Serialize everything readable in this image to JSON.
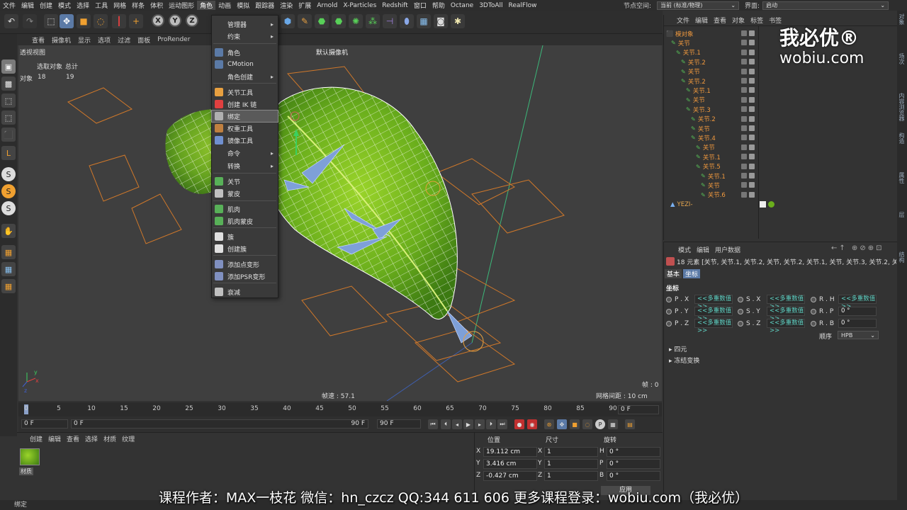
{
  "menubar": {
    "items": [
      "文件",
      "编辑",
      "创建",
      "模式",
      "选择",
      "工具",
      "网格",
      "样条",
      "体积",
      "运动图形",
      "角色",
      "动画",
      "模拟",
      "跟踪器",
      "渲染",
      "扩展",
      "Arnold",
      "X-Particles",
      "Redshift",
      "窗口",
      "帮助",
      "Octane",
      "3DToAll",
      "RealFlow"
    ],
    "active_index": 10,
    "node_space_label": "节点空间:",
    "node_space_value": "当前 (标准/物理)",
    "interface_label": "界面:",
    "interface_value": "启动"
  },
  "viewport_menu": [
    "查看",
    "摄像机",
    "显示",
    "选项",
    "过滤",
    "面板",
    "ProRender"
  ],
  "viewport": {
    "title": "透视视图",
    "camera_label": "默认摄像机",
    "stats_header_selected": "选取对象",
    "stats_header_total": "总计",
    "stats_row_label": "对象",
    "stats_selected": "18",
    "stats_total": "19",
    "speed": "帧速 : 57.1",
    "grid": "网格间距 : 10 cm",
    "frame": "帧 : 0"
  },
  "context_menu": {
    "items": [
      {
        "label": "管理器",
        "sub": true
      },
      {
        "label": "约束",
        "sub": true
      },
      {
        "label": "角色",
        "sub": false
      },
      {
        "label": "CMotion",
        "sub": false
      },
      {
        "label": "角色创建",
        "sub": true
      },
      {
        "label": "关节工具",
        "sub": false
      },
      {
        "label": "创建 IK 链",
        "sub": false
      },
      {
        "label": "绑定",
        "sub": false
      },
      {
        "label": "权重工具",
        "sub": false
      },
      {
        "label": "镜像工具",
        "sub": false
      },
      {
        "label": "命令",
        "sub": true
      },
      {
        "label": "转换",
        "sub": true
      },
      {
        "label": "关节",
        "sub": false
      },
      {
        "label": "蒙皮",
        "sub": false
      },
      {
        "label": "肌肉",
        "sub": false
      },
      {
        "label": "肌肉蒙皮",
        "sub": false
      },
      {
        "label": "簇",
        "sub": false
      },
      {
        "label": "创建簇",
        "sub": false
      },
      {
        "label": "添加点变形",
        "sub": false
      },
      {
        "label": "添加PSR变形",
        "sub": false
      },
      {
        "label": "衰减",
        "sub": false
      }
    ],
    "highlighted_index": 7
  },
  "object_manager": {
    "menu": [
      "文件",
      "编辑",
      "查看",
      "对象",
      "标签",
      "书签"
    ],
    "tree": [
      {
        "label": "模对象",
        "depth": 0
      },
      {
        "label": "关节",
        "depth": 1
      },
      {
        "label": "关节.1",
        "depth": 2
      },
      {
        "label": "关节.2",
        "depth": 3
      },
      {
        "label": "关节",
        "depth": 3
      },
      {
        "label": "关节.2",
        "depth": 3
      },
      {
        "label": "关节.1",
        "depth": 4
      },
      {
        "label": "关节",
        "depth": 4
      },
      {
        "label": "关节.3",
        "depth": 4
      },
      {
        "label": "关节.2",
        "depth": 5
      },
      {
        "label": "关节",
        "depth": 5
      },
      {
        "label": "关节.4",
        "depth": 5
      },
      {
        "label": "关节",
        "depth": 6
      },
      {
        "label": "关节.1",
        "depth": 6
      },
      {
        "label": "关节.5",
        "depth": 6
      },
      {
        "label": "关节.1",
        "depth": 7
      },
      {
        "label": "关节",
        "depth": 7
      },
      {
        "label": "关节.6",
        "depth": 7
      }
    ],
    "mesh_item": "YEZI-"
  },
  "attribute_manager": {
    "menu": [
      "模式",
      "编辑",
      "用户数据"
    ],
    "selection_info": "18 元素 [关节, 关节.1, 关节.2, 关节, 关节.2, 关节.1, 关节, 关节.3, 关节.2, 关",
    "tabs": [
      "基本",
      "坐标"
    ],
    "active_tab": 1,
    "section_title": "坐标",
    "pos_labels": [
      "P . X",
      "P . Y",
      "P . Z"
    ],
    "scale_labels": [
      "S . X",
      "S . Y",
      "S . Z"
    ],
    "rot_labels": [
      "R . H",
      "R . P",
      "R . B"
    ],
    "multi_value": "<<多重数值>>",
    "rot_values": [
      "<<多重数值>>",
      "0 °",
      "0 °"
    ],
    "order_label": "顺序",
    "order_value": "HPB",
    "groups": [
      "四元",
      "冻结变换"
    ]
  },
  "timeline": {
    "ticks": [
      "0",
      "5",
      "10",
      "15",
      "20",
      "25",
      "30",
      "35",
      "40",
      "45",
      "50",
      "55",
      "60",
      "65",
      "70",
      "75",
      "80",
      "85",
      "90"
    ],
    "current_field": "0 F"
  },
  "transport": {
    "start": "0 F",
    "current": "0 F",
    "end1": "90 F",
    "end2": "90 F"
  },
  "material_panel": {
    "menu": [
      "创建",
      "编辑",
      "查看",
      "选择",
      "材质",
      "纹理"
    ],
    "material_name": "材质"
  },
  "coord_panel": {
    "headers": [
      "位置",
      "尺寸",
      "旋转"
    ],
    "rows": [
      {
        "axis": "X",
        "pos": "19.112 cm",
        "size_axis": "X",
        "size": "1",
        "rot_axis": "H",
        "rot": "0 °"
      },
      {
        "axis": "Y",
        "pos": "3.416 cm",
        "size_axis": "Y",
        "size": "1",
        "rot_axis": "P",
        "rot": "0 °"
      },
      {
        "axis": "Z",
        "pos": "-0.427 cm",
        "size_axis": "Z",
        "size": "1",
        "rot_axis": "B",
        "rot": "0 °"
      }
    ],
    "apply": "应用"
  },
  "status_text": "绑定",
  "overlay": {
    "subtitle": "课程作者：MAX一枝花    微信：hn_czcz    QQ:344 611 606    更多课程登录：wobiu.com（我必优）",
    "watermark_cn": "我必优®",
    "watermark_url": "wobiu.com"
  },
  "right_strip": [
    "对象",
    "场次",
    "内容浏览器",
    "构造",
    "属性",
    "层",
    "结构"
  ],
  "colors": {
    "menu_bg": "#2d2d2d",
    "viewport_bg": "#3f3f3f",
    "object_label": "#f29a3e",
    "leaf_green": "#6fb51f",
    "accent_blue": "#5b7aa6"
  }
}
